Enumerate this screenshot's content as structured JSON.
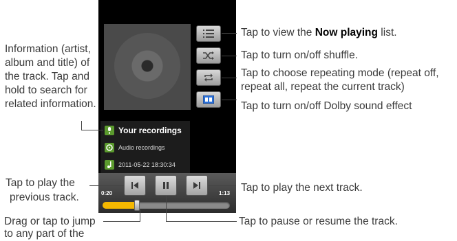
{
  "track": {
    "title": "Your recordings",
    "album": "Audio recordings",
    "date": "2011-05-22 18:30:34"
  },
  "player": {
    "elapsed": "0:20",
    "duration": "1:13",
    "progress_fraction": 0.27
  },
  "icons": {
    "list": "now-playing-list-icon",
    "shuffle": "shuffle-icon",
    "repeat": "repeat-icon",
    "dolby": "dolby-icon",
    "prev": "previous-icon",
    "pause": "pause-icon",
    "next": "next-icon"
  },
  "colors": {
    "progress": "#f5b800",
    "dolby_button": "#2a6fd6",
    "info_icon": "#5b9a2e"
  },
  "annotations": {
    "nowplaying_before": "Tap to view the ",
    "nowplaying_bold": "Now playing",
    "nowplaying_after": " list.",
    "shuffle": "Tap to turn on/off shuffle.",
    "repeat_1": "Tap to choose repeating mode (repeat off,",
    "repeat_2": "repeat all, repeat the current track)",
    "dolby": "Tap to turn on/off Dolby sound effect",
    "info_1": "Information (artist,",
    "info_2": "album and title) of",
    "info_3": "the track. Tap and",
    "info_4": "hold to search for",
    "info_5": "related information.",
    "prev_1": "Tap to play the",
    "prev_2": "previous track.",
    "next": "Tap to play the next track.",
    "seek_1": "Drag or tap to jump",
    "seek_2": "to any part of the",
    "pause": "Tap to pause or resume the track."
  }
}
